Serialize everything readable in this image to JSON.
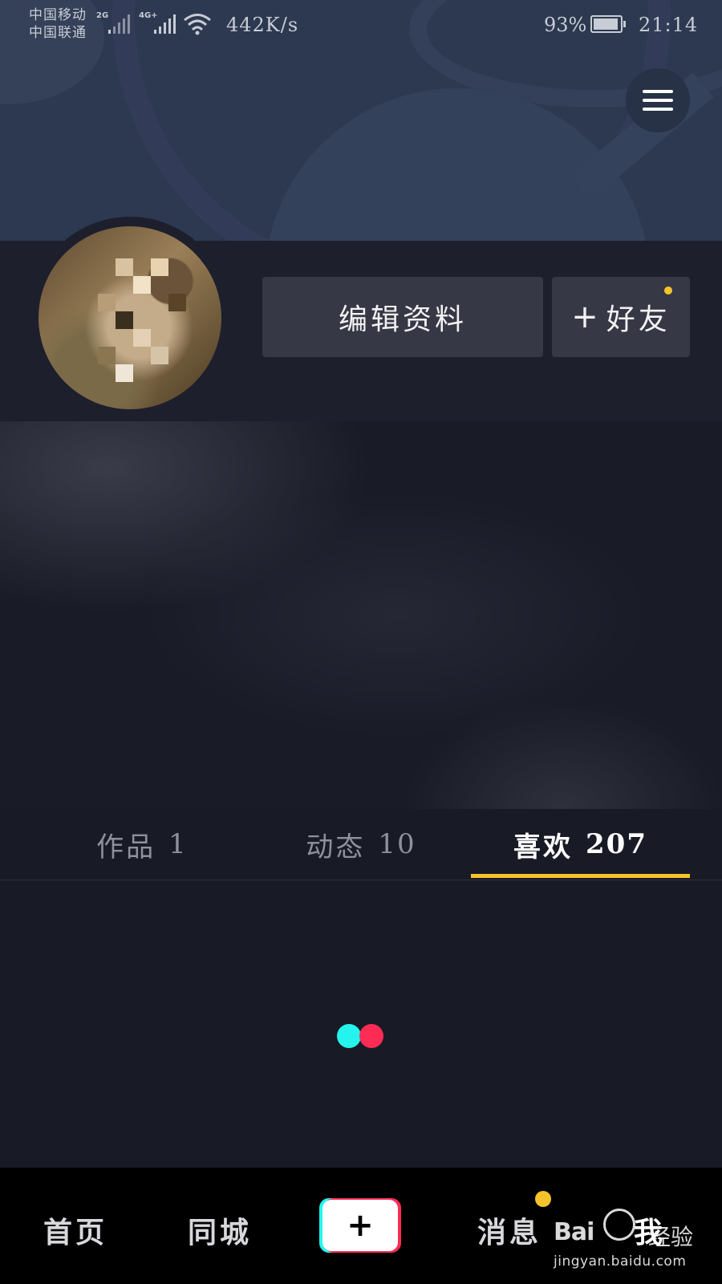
{
  "status_bar": {
    "carrier_1": "中国移动",
    "carrier_2": "中国联通",
    "net_1": "2G",
    "net_2": "4G+",
    "speed": "442K/s",
    "battery_percent": "93%",
    "battery_level": 0.93,
    "time": "21:14"
  },
  "header": {
    "menu_icon": "hamburger-menu-icon"
  },
  "profile": {
    "edit_button": "编辑资料",
    "add_friend_plus": "+",
    "add_friend_label": "好友"
  },
  "tabs": [
    {
      "label": "作品",
      "count": "1",
      "active": false
    },
    {
      "label": "动态",
      "count": "10",
      "active": false
    },
    {
      "label": "喜欢",
      "count": "207",
      "active": true
    }
  ],
  "bottom_nav": {
    "home": "首页",
    "city": "同城",
    "create": "+",
    "messages": "消息",
    "me": "我"
  },
  "watermark": {
    "brand": "Bai",
    "brand_suffix": "经验",
    "url": "jingyan.baidu.com"
  },
  "colors": {
    "accent": "#f5c32c",
    "background": "#181a26",
    "loader_cyan": "#25f4ee",
    "loader_red": "#fe2c55"
  }
}
